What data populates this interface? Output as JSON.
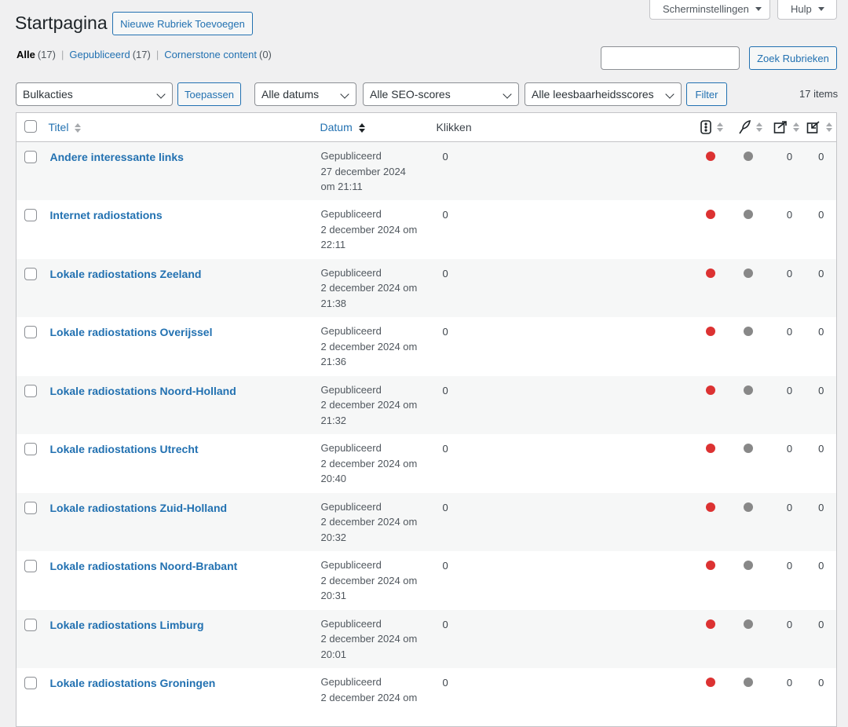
{
  "screen_options": {
    "screen_label": "Scherminstellingen",
    "help_label": "Hulp"
  },
  "page": {
    "title": "Startpagina",
    "add_button": "Nieuwe Rubriek Toevoegen"
  },
  "views": {
    "all": {
      "label": "Alle",
      "count": "(17)"
    },
    "published": {
      "label": "Gepubliceerd",
      "count": "(17)"
    },
    "cornerstone": {
      "label": "Cornerstone content",
      "count": "(0)"
    },
    "separator": "|"
  },
  "search": {
    "value": "",
    "button": "Zoek Rubrieken"
  },
  "filters": {
    "bulk": "Bulkacties",
    "apply": "Toepassen",
    "dates": "Alle datums",
    "seo": "Alle SEO-scores",
    "readability": "Alle leesbaarheidsscores",
    "filter": "Filter",
    "items": "17 items"
  },
  "columns": {
    "title": "Titel",
    "date": "Datum",
    "clicks": "Klikken"
  },
  "icons": {
    "seo_score": "traffic-light-icon",
    "readability": "feather-icon",
    "outgoing_links": "outgoing-links-icon",
    "incoming_links": "incoming-links-icon"
  },
  "colors": {
    "red": "#dc3232",
    "grey": "#888888",
    "link": "#2271b1"
  },
  "rows": [
    {
      "title": "Andere interessante links",
      "status": "Gepubliceerd",
      "date_line": "27 december 2024",
      "time_line": "om 21:11",
      "clicks": "0",
      "seo": "red",
      "readability": "grey",
      "out": "0",
      "in": "0"
    },
    {
      "title": "Internet radiostations",
      "status": "Gepubliceerd",
      "date_line": "2 december 2024 om",
      "time_line": "22:11",
      "clicks": "0",
      "seo": "red",
      "readability": "grey",
      "out": "0",
      "in": "0"
    },
    {
      "title": "Lokale radiostations Zeeland",
      "status": "Gepubliceerd",
      "date_line": "2 december 2024 om",
      "time_line": "21:38",
      "clicks": "0",
      "seo": "red",
      "readability": "grey",
      "out": "0",
      "in": "0"
    },
    {
      "title": "Lokale radiostations Overijssel",
      "status": "Gepubliceerd",
      "date_line": "2 december 2024 om",
      "time_line": "21:36",
      "clicks": "0",
      "seo": "red",
      "readability": "grey",
      "out": "0",
      "in": "0"
    },
    {
      "title": "Lokale radiostations Noord-Holland",
      "status": "Gepubliceerd",
      "date_line": "2 december 2024 om",
      "time_line": "21:32",
      "clicks": "0",
      "seo": "red",
      "readability": "grey",
      "out": "0",
      "in": "0"
    },
    {
      "title": "Lokale radiostations Utrecht",
      "status": "Gepubliceerd",
      "date_line": "2 december 2024 om",
      "time_line": "20:40",
      "clicks": "0",
      "seo": "red",
      "readability": "grey",
      "out": "0",
      "in": "0"
    },
    {
      "title": "Lokale radiostations Zuid-Holland",
      "status": "Gepubliceerd",
      "date_line": "2 december 2024 om",
      "time_line": "20:32",
      "clicks": "0",
      "seo": "red",
      "readability": "grey",
      "out": "0",
      "in": "0"
    },
    {
      "title": "Lokale radiostations Noord-Brabant",
      "status": "Gepubliceerd",
      "date_line": "2 december 2024 om",
      "time_line": "20:31",
      "clicks": "0",
      "seo": "red",
      "readability": "grey",
      "out": "0",
      "in": "0"
    },
    {
      "title": "Lokale radiostations Limburg",
      "status": "Gepubliceerd",
      "date_line": "2 december 2024 om",
      "time_line": "20:01",
      "clicks": "0",
      "seo": "red",
      "readability": "grey",
      "out": "0",
      "in": "0"
    },
    {
      "title": "Lokale radiostations Groningen",
      "status": "Gepubliceerd",
      "date_line": "2 december 2024 om",
      "time_line": "",
      "clicks": "0",
      "seo": "red",
      "readability": "grey",
      "out": "0",
      "in": "0"
    }
  ]
}
